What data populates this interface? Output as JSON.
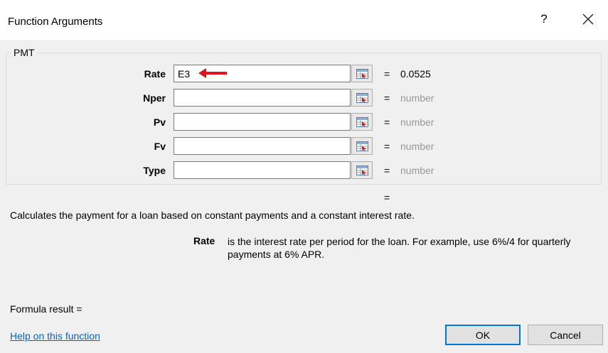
{
  "window": {
    "title": "Function Arguments",
    "help_label": "?"
  },
  "function": {
    "name": "PMT",
    "arguments": [
      {
        "label": "Rate",
        "value": "E3",
        "result": "0.0525",
        "result_muted": false
      },
      {
        "label": "Nper",
        "value": "",
        "result": "number",
        "result_muted": true
      },
      {
        "label": "Pv",
        "value": "",
        "result": "number",
        "result_muted": true
      },
      {
        "label": "Fv",
        "value": "",
        "result": "number",
        "result_muted": true
      },
      {
        "label": "Type",
        "value": "",
        "result": "number",
        "result_muted": true
      }
    ],
    "equals_sign": "=",
    "overall_result": "=",
    "description": "Calculates the payment for a loan based on constant payments and a constant interest rate.",
    "arg_help_name": "Rate",
    "arg_help_text": "is the interest rate per period for the loan. For example, use 6%/4 for quarterly payments at 6% APR."
  },
  "footer": {
    "formula_result_label": "Formula result =",
    "help_link": "Help on this function",
    "ok_label": "OK",
    "cancel_label": "Cancel"
  },
  "colors": {
    "annotation_arrow": "#e0141e",
    "link": "#0066cc",
    "focus_border": "#0078d7"
  }
}
